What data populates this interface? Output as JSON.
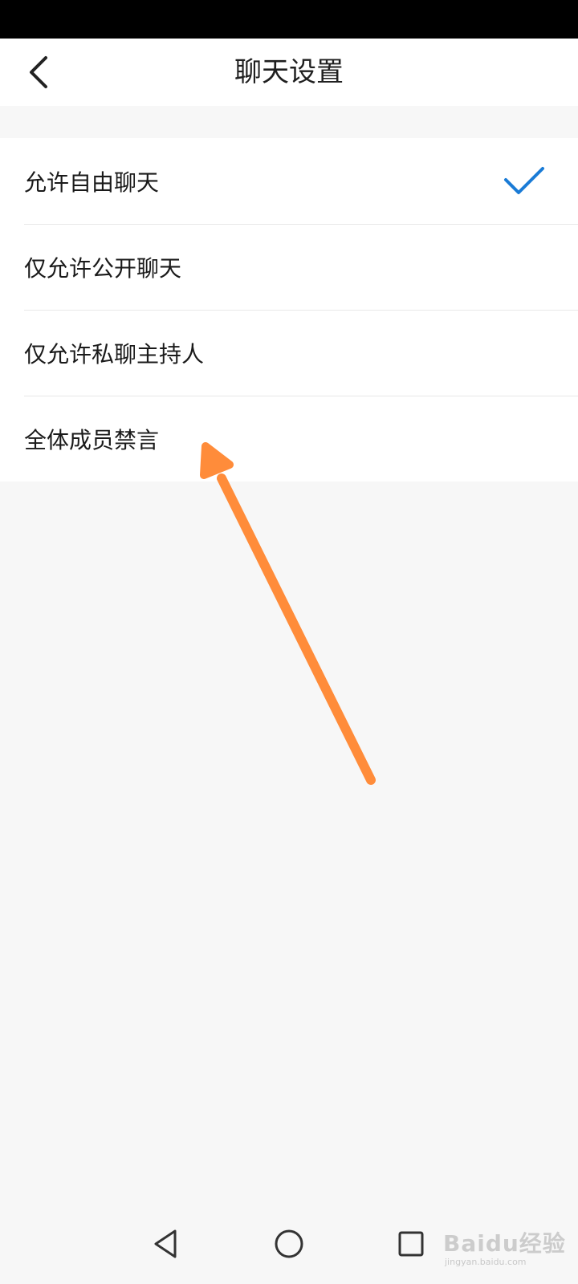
{
  "header": {
    "title": "聊天设置",
    "back_icon": "chevron-left-icon"
  },
  "options": [
    {
      "label": "允许自由聊天",
      "selected": true
    },
    {
      "label": "仅允许公开聊天",
      "selected": false
    },
    {
      "label": "仅允许私聊主持人",
      "selected": false
    },
    {
      "label": "全体成员禁言",
      "selected": false
    }
  ],
  "colors": {
    "accent": "#1a7bd6",
    "annotation_arrow": "#ff8c3a",
    "background": "#f7f7f7",
    "surface": "#ffffff",
    "divider": "#e8e8e8"
  },
  "nav": {
    "back_icon": "triangle-back-icon",
    "home_icon": "circle-home-icon",
    "recents_icon": "square-recents-icon"
  },
  "watermark": {
    "brand": "Baidu经验",
    "url": "jingyan.baidu.com"
  }
}
